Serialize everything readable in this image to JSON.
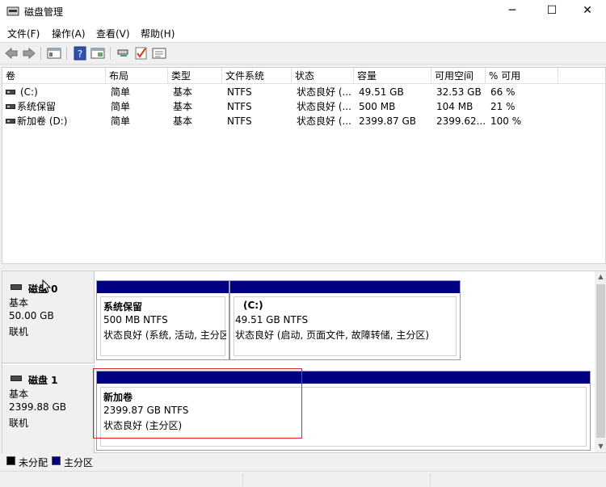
{
  "window": {
    "title": "磁盘管理",
    "min_glyph": "─",
    "max_glyph": "☐",
    "close_glyph": "✕"
  },
  "menu": [
    {
      "label": "文件(F)"
    },
    {
      "label": "操作(A)"
    },
    {
      "label": "查看(V)"
    },
    {
      "label": "帮助(H)"
    }
  ],
  "toolbar": {
    "icons": [
      "back-icon",
      "forward-icon",
      "console-tree-icon",
      "help-icon",
      "properties-icon",
      "connect-icon",
      "check-icon",
      "settings-icon"
    ]
  },
  "volume_list": {
    "columns": [
      "卷",
      "布局",
      "类型",
      "文件系统",
      "状态",
      "容量",
      "可用空间",
      "% 可用"
    ],
    "rows": [
      {
        "volume": "(C:)",
        "layout": "简单",
        "type": "基本",
        "fs": "NTFS",
        "status": "状态良好 (...",
        "capacity": "49.51 GB",
        "free": "32.53 GB",
        "pct": "66 %"
      },
      {
        "volume": "系统保留",
        "layout": "简单",
        "type": "基本",
        "fs": "NTFS",
        "status": "状态良好 (...",
        "capacity": "500 MB",
        "free": "104 MB",
        "pct": "21 %"
      },
      {
        "volume": "新加卷 (D:)",
        "layout": "简单",
        "type": "基本",
        "fs": "NTFS",
        "status": "状态良好 (...",
        "capacity": "2399.87 GB",
        "free": "2399.62...",
        "pct": "100 %"
      }
    ]
  },
  "disks": [
    {
      "name": "磁盘 0",
      "type": "基本",
      "size": "50.00 GB",
      "state": "联机",
      "partitions": [
        {
          "name": "系统保留",
          "size_fs": "500 MB NTFS",
          "status": "状态良好 (系统, 活动, 主分区"
        },
        {
          "name": "(C:)",
          "size_fs": "49.51 GB NTFS",
          "status": "状态良好 (启动, 页面文件, 故障转储, 主分区)"
        }
      ]
    },
    {
      "name": "磁盘 1",
      "type": "基本",
      "size": "2399.88 GB",
      "state": "联机",
      "partitions": [
        {
          "name": "新加卷",
          "size_fs": "2399.87 GB NTFS",
          "status": "状态良好 (主分区)"
        }
      ]
    }
  ],
  "legend": [
    {
      "label": "未分配",
      "color": "#000000"
    },
    {
      "label": "主分区",
      "color": "#000080"
    }
  ],
  "colors": {
    "primary_partition": "#000080",
    "highlight": "#e02020"
  }
}
